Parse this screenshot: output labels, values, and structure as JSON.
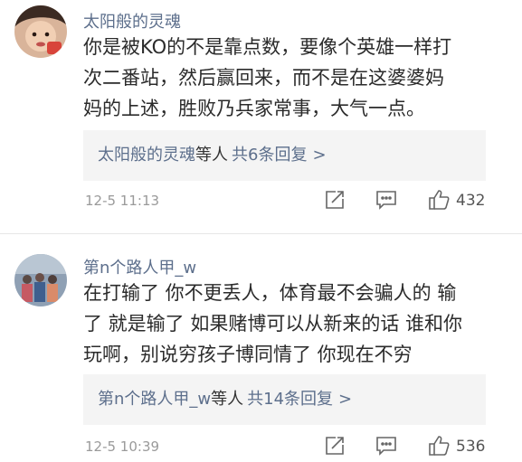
{
  "comments": [
    {
      "username": "太阳般的灵魂",
      "lines": [
        "你是被KO的不是靠点数，要像个英雄一样打",
        "次二番站，然后赢回来，而不是在这婆婆妈",
        "妈的上述，胜败乃兵家常事，大气一点。"
      ],
      "reply_user": "太阳般的灵魂",
      "reply_suffix": "等人",
      "reply_count": "共6条回复",
      "reply_arrow": ">",
      "time": "12-5 11:13",
      "likes": "432"
    },
    {
      "username": "第n个路人甲_w",
      "lines": [
        "在打输了 你不更丢人，体育最不会骗人的 输",
        "了 就是输了 如果赌博可以从新来的话 谁和你",
        "玩啊，别说穷孩子博同情了 你现在不穷"
      ],
      "reply_user": "第n个路人甲_w",
      "reply_suffix": "等人",
      "reply_count": "共14条回复",
      "reply_arrow": ">",
      "time": "12-5 10:39",
      "likes": "536"
    }
  ],
  "icons": {
    "share": "share-icon",
    "comment": "comment-icon",
    "like": "thumbs-up-icon"
  },
  "colors": {
    "username": "#5d6f8c",
    "body_text": "#2b2b2b",
    "meta_gray": "#9a9a9a",
    "reply_box_bg": "#f4f4f4"
  }
}
